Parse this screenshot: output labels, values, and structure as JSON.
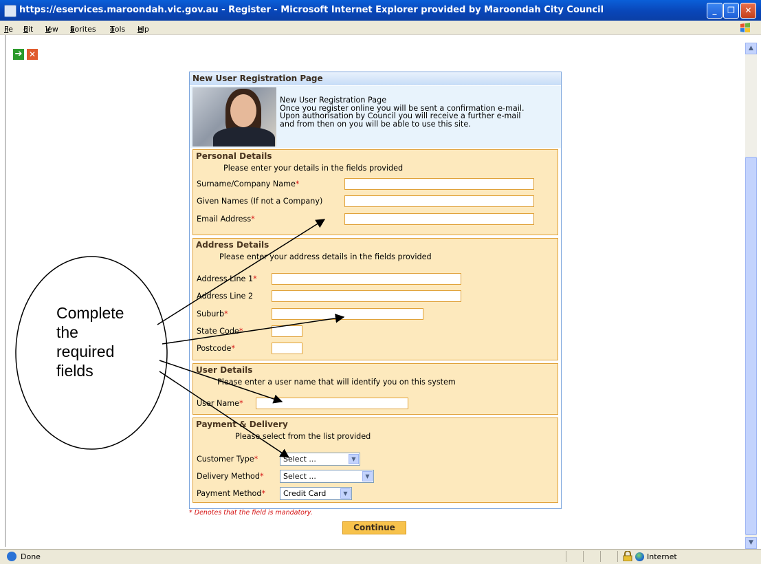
{
  "window": {
    "title": "https://eservices.maroondah.vic.gov.au - Register - Microsoft Internet Explorer provided by Maroondah City Council",
    "minimize": "_",
    "restore": "❐",
    "close": "✕"
  },
  "menu": [
    {
      "pre": "",
      "u": "F",
      "post": "ile"
    },
    {
      "pre": "",
      "u": "E",
      "post": "dit"
    },
    {
      "pre": "",
      "u": "V",
      "post": "iew"
    },
    {
      "pre": "F",
      "u": "a",
      "post": "vorites"
    },
    {
      "pre": "",
      "u": "T",
      "post": "ools"
    },
    {
      "pre": "",
      "u": "H",
      "post": "elp"
    }
  ],
  "toolbar": {
    "go_icon": "arrow-right-icon",
    "stop_icon": "close-icon"
  },
  "panel": {
    "title": "New User Registration Page",
    "intro_lines": [
      "New User Registration Page",
      "Once you register online you will be sent a confirmation e-mail.",
      "Upon authorisation by Council you will receive a further e-mail",
      "and from then on you will be able to use this site."
    ]
  },
  "personal": {
    "heading": "Personal Details",
    "sub": "Please enter your details in the fields provided",
    "surname_label": "Surname/Company Name",
    "given_label": "Given Names (If not a Company)",
    "email_label": "Email Address"
  },
  "address": {
    "heading": "Address Details",
    "sub": "Please enter your address details in the fields provided",
    "line1_label": "Address Line 1",
    "line2_label": "Address Line 2",
    "suburb_label": "Suburb",
    "state_label": "State Code",
    "postcode_label": "Postcode"
  },
  "user": {
    "heading": "User Details",
    "sub": "Please enter a user name that will identify you on this system",
    "username_label": "User Name"
  },
  "payment": {
    "heading": "Payment & Delivery",
    "sub": "Please select from the list provided",
    "customer_label": "Customer Type",
    "customer_value": "Select ...",
    "delivery_label": "Delivery Method",
    "delivery_value": "Select ...",
    "payment_label": "Payment Method",
    "payment_value": "Credit Card"
  },
  "required_mark": "*",
  "mandatory_note": "* Denotes that the field is mandatory.",
  "continue_label": "Continue",
  "callout": {
    "lines": [
      "Complete",
      "the",
      "required",
      "fields"
    ]
  },
  "status": {
    "text": "Done",
    "zone": "Internet"
  }
}
